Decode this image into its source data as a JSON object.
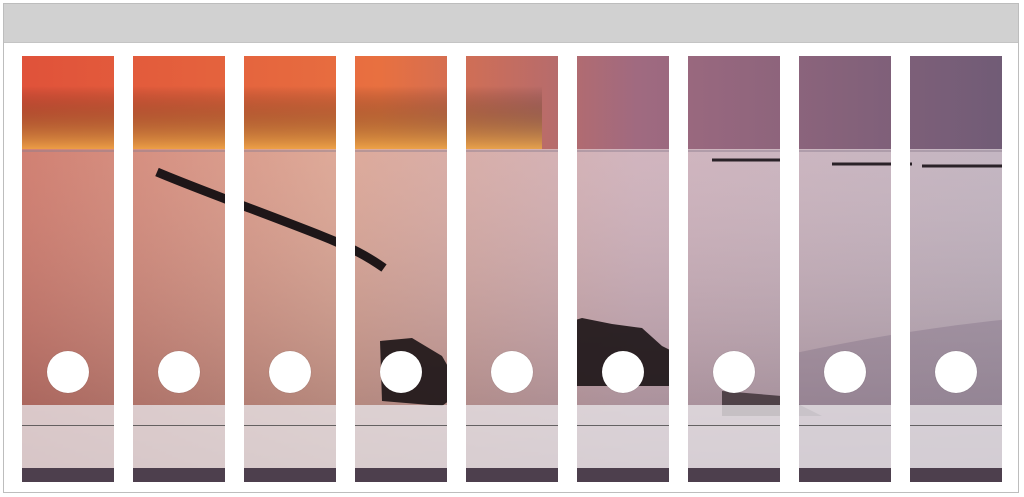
{
  "sheet": {
    "spine_count": 9,
    "image": "sunset-beach-breakwater",
    "colors": {
      "sky_top": "#e0523a",
      "sky_glow": "#f7b24a",
      "sky_dusk": "#6b5a75",
      "sea": "#c9a8b3",
      "label_overlay": "#e8e4e8",
      "frame_bar": "#d1d1d1"
    }
  },
  "spines": [
    {
      "id": 1
    },
    {
      "id": 2
    },
    {
      "id": 3
    },
    {
      "id": 4
    },
    {
      "id": 5
    },
    {
      "id": 6
    },
    {
      "id": 7
    },
    {
      "id": 8
    },
    {
      "id": 9
    }
  ]
}
